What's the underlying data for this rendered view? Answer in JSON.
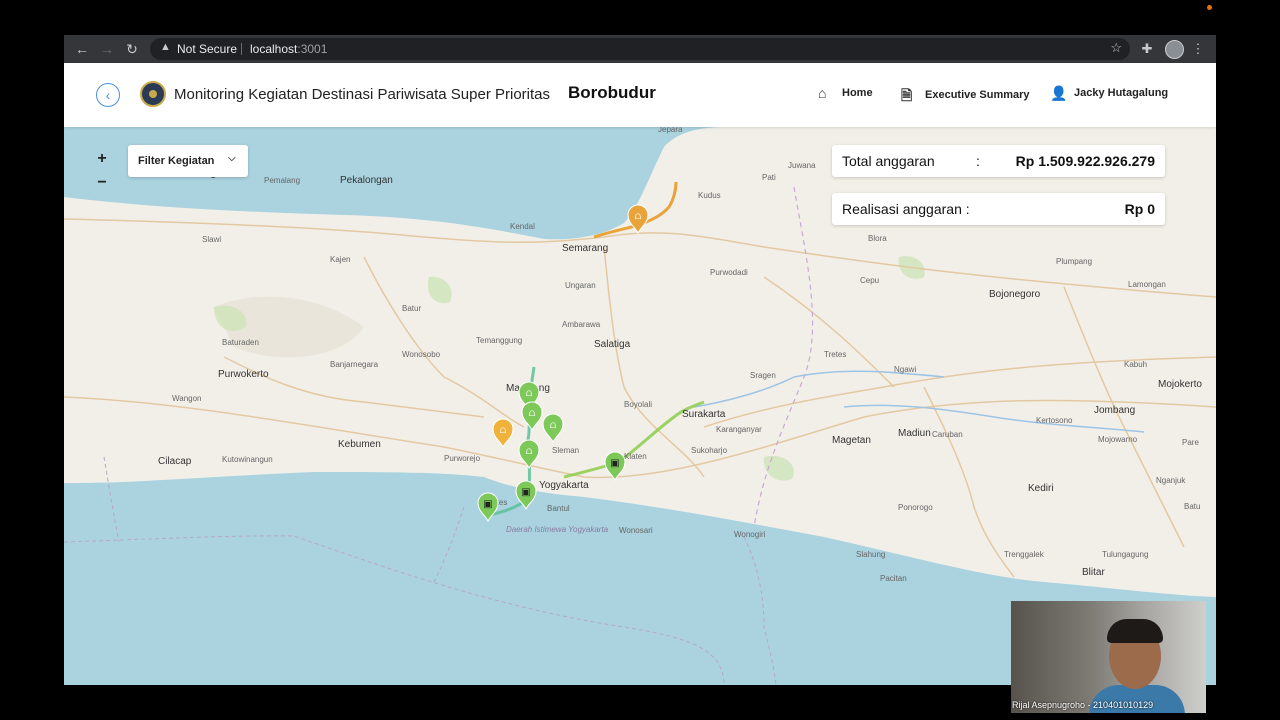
{
  "browser": {
    "security_label": "Not Secure",
    "url_host": "localhost",
    "url_port": ":3001"
  },
  "header": {
    "title": "Monitoring Kegiatan Destinasi Pariwisata Super Prioritas",
    "destination": "Borobudur",
    "nav": {
      "home": "Home",
      "executive_summary": "Executive Summary",
      "user": "Jacky Hutagalung"
    }
  },
  "map": {
    "zoom_in": "+",
    "zoom_out": "−",
    "filter_label": "Filter Kegiatan",
    "budget": {
      "total_label": "Total anggaran",
      "total_colon": ":",
      "total_value": "Rp 1.509.922.926.279",
      "realisasi_label": "Realisasi anggaran :",
      "realisasi_value": "Rp 0"
    },
    "places": [
      {
        "name": "Jepara",
        "size": "s"
      },
      {
        "name": "Juwana",
        "size": "s"
      },
      {
        "name": "Kudus",
        "size": "s"
      },
      {
        "name": "Pati",
        "size": "s"
      },
      {
        "name": "Tegal",
        "size": "m"
      },
      {
        "name": "Pemalang",
        "size": "s"
      },
      {
        "name": "Pekalongan",
        "size": "m"
      },
      {
        "name": "Kendal",
        "size": "s"
      },
      {
        "name": "Semarang",
        "size": "m"
      },
      {
        "name": "Slawi",
        "size": "s"
      },
      {
        "name": "Kajen",
        "size": "s"
      },
      {
        "name": "Ungaran",
        "size": "s"
      },
      {
        "name": "Purwodadi",
        "size": "s"
      },
      {
        "name": "Blora",
        "size": "s"
      },
      {
        "name": "Cepu",
        "size": "s"
      },
      {
        "name": "Plumpang",
        "size": "s"
      },
      {
        "name": "Bojonegoro",
        "size": "m"
      },
      {
        "name": "Lamongan",
        "size": "s"
      },
      {
        "name": "Batur",
        "size": "s"
      },
      {
        "name": "Ambarawa",
        "size": "s"
      },
      {
        "name": "Baturaden",
        "size": "s"
      },
      {
        "name": "Wonosobo",
        "size": "s"
      },
      {
        "name": "Temanggung",
        "size": "s"
      },
      {
        "name": "Salatiga",
        "size": "m"
      },
      {
        "name": "Purwokerto",
        "size": "m"
      },
      {
        "name": "Banjarnegara",
        "size": "s"
      },
      {
        "name": "Boyolali",
        "size": "s"
      },
      {
        "name": "Sragen",
        "size": "s"
      },
      {
        "name": "Tretes",
        "size": "s"
      },
      {
        "name": "Ngawi",
        "size": "s"
      },
      {
        "name": "Kabuh",
        "size": "s"
      },
      {
        "name": "Mojokerto",
        "size": "m"
      },
      {
        "name": "Wangon",
        "size": "s"
      },
      {
        "name": "Magelang",
        "size": "m"
      },
      {
        "name": "Surakarta",
        "size": "m"
      },
      {
        "name": "Karanganyar",
        "size": "s"
      },
      {
        "name": "Caruban",
        "size": "s"
      },
      {
        "name": "Jombang",
        "size": "m"
      },
      {
        "name": "Magetan",
        "size": "m"
      },
      {
        "name": "Madiun",
        "size": "m"
      },
      {
        "name": "Kebumen",
        "size": "m"
      },
      {
        "name": "Purworejo",
        "size": "s"
      },
      {
        "name": "Sleman",
        "size": "s"
      },
      {
        "name": "Klaten",
        "size": "s"
      },
      {
        "name": "Sukoharjo",
        "size": "s"
      },
      {
        "name": "Kertosono",
        "size": "s"
      },
      {
        "name": "Mojowarno",
        "size": "s"
      },
      {
        "name": "Cilacap",
        "size": "m"
      },
      {
        "name": "Kutowinangun",
        "size": "s"
      },
      {
        "name": "Yogyakarta",
        "size": "m"
      },
      {
        "name": "Pare",
        "size": "s"
      },
      {
        "name": "Kediri",
        "size": "m"
      },
      {
        "name": "Wates",
        "size": "s"
      },
      {
        "name": "Bantul",
        "size": "s"
      },
      {
        "name": "Ponorogo",
        "size": "s"
      },
      {
        "name": "Nganjuk",
        "size": "s"
      },
      {
        "name": "Batu",
        "size": "s"
      },
      {
        "name": "Daerah Istimewa Yogyakarta",
        "size": "s"
      },
      {
        "name": "Wonosari",
        "size": "s"
      },
      {
        "name": "Wonogiri",
        "size": "s"
      },
      {
        "name": "Slahung",
        "size": "s"
      },
      {
        "name": "Trenggalek",
        "size": "s"
      },
      {
        "name": "Tulungagung",
        "size": "s"
      },
      {
        "name": "Blitar",
        "size": "m"
      },
      {
        "name": "Pacitan",
        "size": "s"
      }
    ],
    "markers": [
      {
        "type": "train",
        "color": "#e8a33a"
      },
      {
        "type": "train",
        "color": "#f0b23a"
      },
      {
        "type": "train",
        "color": "#7cc95a"
      },
      {
        "type": "train",
        "color": "#7cc95a"
      },
      {
        "type": "train",
        "color": "#7cc95a"
      },
      {
        "type": "train",
        "color": "#7cc95a"
      },
      {
        "type": "bus",
        "color": "#7cc95a"
      },
      {
        "type": "bus",
        "color": "#7cc95a"
      },
      {
        "type": "bus",
        "color": "#7cc95a"
      }
    ]
  },
  "webcam": {
    "name": "Rijal Asepnugroho - 2104010101​29"
  }
}
